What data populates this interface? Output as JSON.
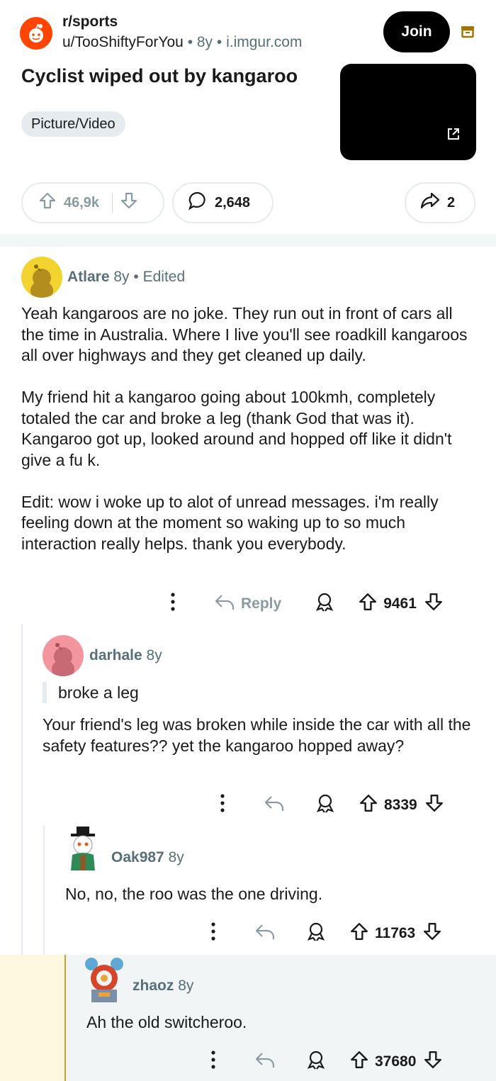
{
  "post": {
    "subreddit": "r/sports",
    "author": "u/TooShiftyForYou",
    "age": "8y",
    "domain": "i.imgur.com",
    "join_label": "Join",
    "title": "Cyclist wiped out by kangaroo",
    "flair": "Picture/Video",
    "votes": "46,9k",
    "comments": "2,648",
    "shares": "2",
    "brand_color": "#ff4500"
  },
  "comments": [
    {
      "user": "Atlare",
      "age": "8y",
      "edited": "Edited",
      "body": [
        "Yeah kangaroos are no joke. They run out in front of cars all the time in Australia. Where I live you'll see roadkill kangaroos all over highways and they get cleaned up daily.",
        "My friend hit a kangaroo going about 100kmh, completely totaled the car and broke a leg (thank God that was it). Kangaroo got up, looked around and hopped off like it didn't give a fu k.",
        "Edit: wow i woke up to alot of unread messages. i'm really feeling down at the moment so waking up to so much interaction really helps. thank you everybody."
      ],
      "reply_label": "Reply",
      "score": "9461"
    },
    {
      "user": "darhale",
      "age": "8y",
      "quote": "broke a leg",
      "body": [
        "Your friend's leg was broken while inside the car with all the safety features?? yet the kangaroo hopped away?"
      ],
      "score": "8339"
    },
    {
      "user": "Oak987",
      "age": "8y",
      "body": [
        "No, no, the roo was the one driving."
      ],
      "score": "11763"
    },
    {
      "user": "zhaoz",
      "age": "8y",
      "body": [
        "Ah the old switcheroo."
      ],
      "score": "37680"
    }
  ]
}
